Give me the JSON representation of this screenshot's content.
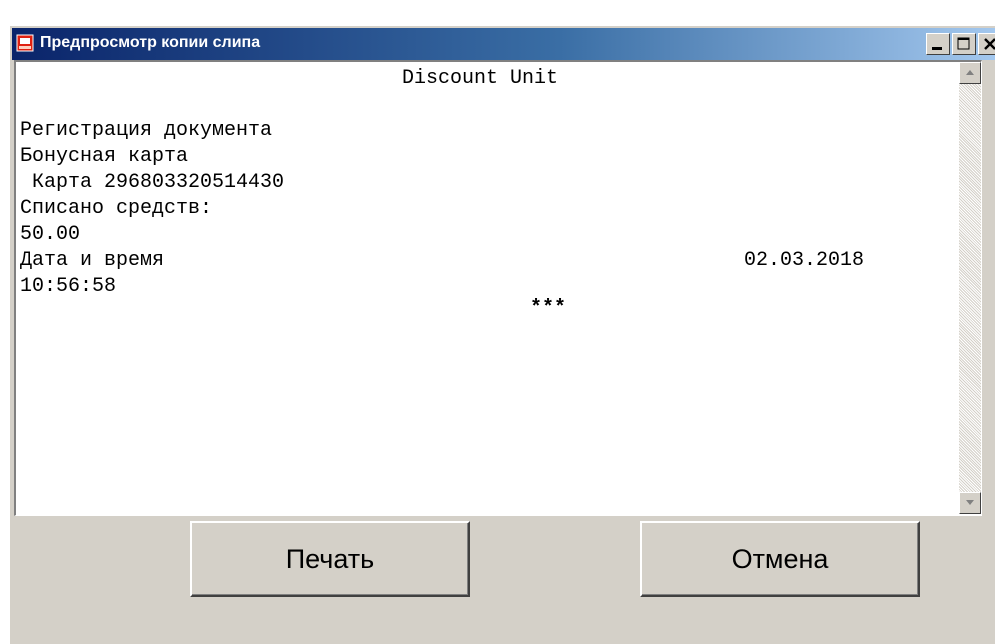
{
  "window": {
    "title": "Предпросмотр копии слипа",
    "icon": "printer-icon"
  },
  "title_buttons": {
    "minimize_icon": "minimize-icon",
    "maximize_icon": "maximize-icon",
    "close_icon": "close-icon"
  },
  "receipt": {
    "header": "Discount Unit",
    "lines": [
      "Регистрация документа",
      "Бонусная карта",
      " Карта 296803320514430",
      "Списано средств:",
      "50.00"
    ],
    "datetime_label": "Дата и время",
    "date": "02.03.2018",
    "time": "10:56:58",
    "footer": "***"
  },
  "buttons": {
    "print": "Печать",
    "cancel": "Отмена"
  },
  "colors": {
    "title_gradient_start": "#0a246a",
    "title_gradient_end": "#a6caf0",
    "dialog_face": "#d4d0c8"
  }
}
